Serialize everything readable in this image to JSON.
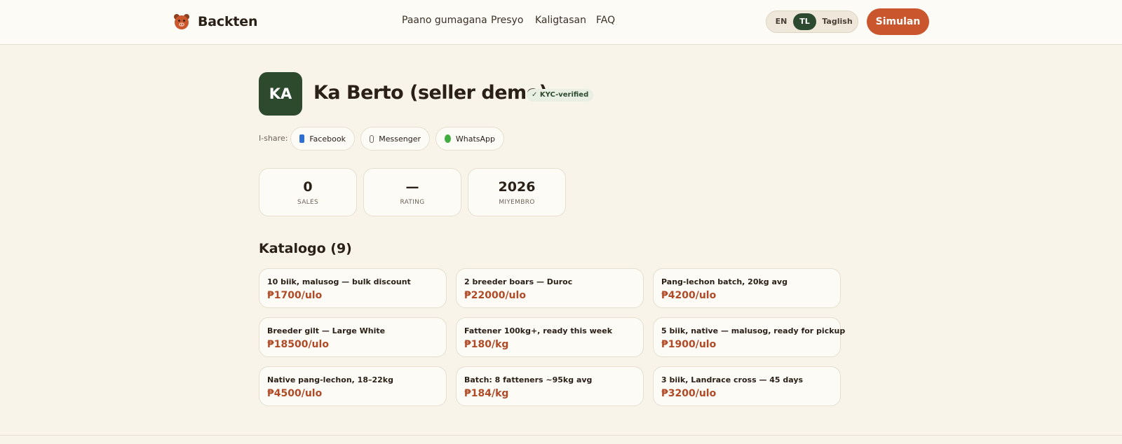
{
  "header": {
    "brand": "Backten",
    "nav": [
      "Paano gumagana",
      "Presyo",
      "Kaligtasan",
      "FAQ"
    ],
    "lang": {
      "en": "EN",
      "tl": "TL",
      "taglish": "Taglish",
      "selected": "TL"
    },
    "cta": "Simulan"
  },
  "profile": {
    "initials": "KA",
    "name": "Ka Berto (seller demo)",
    "kyc": "✓ KYC-verified",
    "share_label": "I-share:",
    "share": [
      {
        "label": "Facebook",
        "icon": "facebook-icon"
      },
      {
        "label": "Messenger",
        "icon": "messenger-icon"
      },
      {
        "label": "WhatsApp",
        "icon": "whatsapp-icon"
      }
    ]
  },
  "stats": [
    {
      "value": "0",
      "label": "SALES"
    },
    {
      "value": "—",
      "label": "RATING"
    },
    {
      "value": "2026",
      "label": "MIYEMBRO"
    }
  ],
  "catalog": {
    "title": "Katalogo (9)",
    "items": [
      {
        "title": "10 biik, malusog — bulk discount",
        "price": "₱1700/ulo"
      },
      {
        "title": "2 breeder boars — Duroc",
        "price": "₱22000/ulo"
      },
      {
        "title": "Pang-lechon batch, 20kg avg",
        "price": "₱4200/ulo"
      },
      {
        "title": "Breeder gilt — Large White",
        "price": "₱18500/ulo"
      },
      {
        "title": "Fattener 100kg+, ready this week",
        "price": "₱180/kg"
      },
      {
        "title": "5 biik, native — malusog, ready for pickup",
        "price": "₱1900/ulo"
      },
      {
        "title": "Native pang-lechon, 18–22kg",
        "price": "₱4500/ulo"
      },
      {
        "title": "Batch: 8 fatteners ~95kg avg",
        "price": "₱184/kg"
      },
      {
        "title": "3 biik, Landrace cross — 45 days",
        "price": "₱3200/ulo"
      }
    ]
  },
  "colors": {
    "accent": "#c9562c",
    "brand_green": "#2d4a2f",
    "price": "#b04a26",
    "background": "#f8f4ea"
  }
}
